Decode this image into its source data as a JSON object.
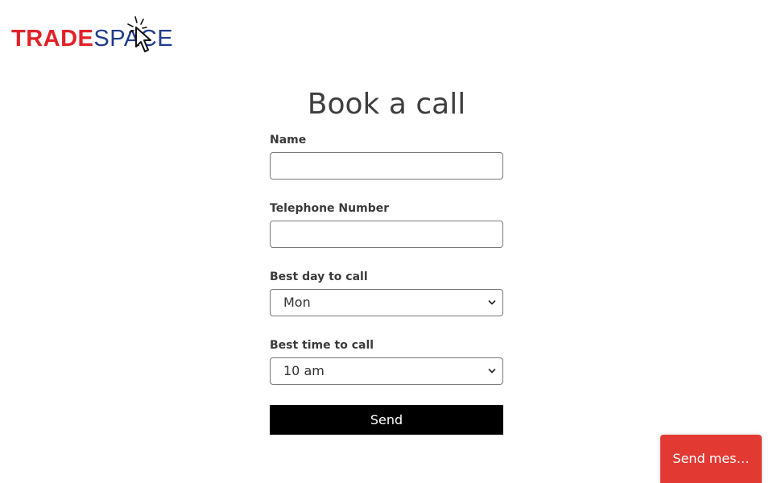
{
  "brand": {
    "logo_part1": "TRADE",
    "logo_part2": "SPACE",
    "logo_icon": "cursor-click-icon",
    "colors": {
      "red": "#e02229",
      "blue": "#1f3b8c"
    }
  },
  "form": {
    "title": "Book a call",
    "name_label": "Name",
    "name_value": "",
    "phone_label": "Telephone Number",
    "phone_value": "",
    "day_label": "Best day to call",
    "day_value": "Mon",
    "time_label": "Best time to call",
    "time_value": "10 am",
    "send_label": "Send"
  },
  "chat": {
    "label": "Send mes…",
    "color": "#e23a33"
  }
}
